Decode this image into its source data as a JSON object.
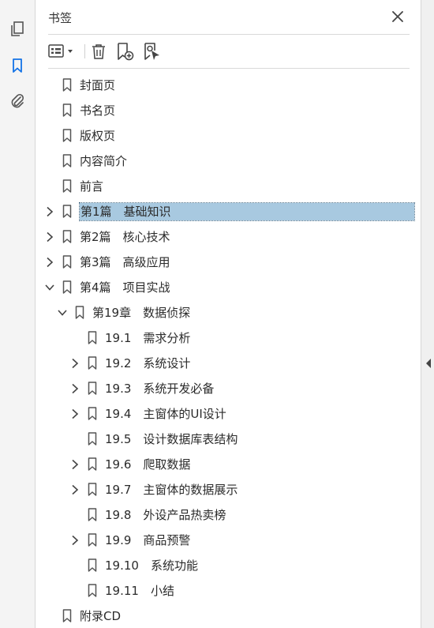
{
  "panel": {
    "title": "书签"
  },
  "rail": {
    "icons": [
      "pages-icon",
      "bookmark-icon",
      "attachment-icon"
    ]
  },
  "toolbar": {
    "buttons": [
      "options-menu-icon",
      "delete-bookmark-icon",
      "new-bookmark-icon",
      "bookmark-from-selection-icon"
    ]
  },
  "colors": {
    "selection": "#a8c9e0",
    "accent": "#1473e6",
    "icon": "#555555"
  },
  "bookmarks": [
    {
      "label": "封面页",
      "level": 0,
      "expander": "none"
    },
    {
      "label": "书名页",
      "level": 0,
      "expander": "none"
    },
    {
      "label": "版权页",
      "level": 0,
      "expander": "none"
    },
    {
      "label": "内容简介",
      "level": 0,
      "expander": "none"
    },
    {
      "label": "前言",
      "level": 0,
      "expander": "none"
    },
    {
      "label": "第1篇　基础知识",
      "level": 0,
      "expander": "collapsed",
      "selected": true
    },
    {
      "label": "第2篇　核心技术",
      "level": 0,
      "expander": "collapsed"
    },
    {
      "label": "第3篇　高级应用",
      "level": 0,
      "expander": "collapsed"
    },
    {
      "label": "第4篇　项目实战",
      "level": 0,
      "expander": "expanded"
    },
    {
      "label": "第19章　数据侦探",
      "level": 1,
      "expander": "expanded"
    },
    {
      "label": "19.1　需求分析",
      "level": 2,
      "expander": "none"
    },
    {
      "label": "19.2　系统设计",
      "level": 2,
      "expander": "collapsed"
    },
    {
      "label": "19.3　系统开发必备",
      "level": 2,
      "expander": "collapsed"
    },
    {
      "label": "19.4　主窗体的UI设计",
      "level": 2,
      "expander": "collapsed"
    },
    {
      "label": "19.5　设计数据库表结构",
      "level": 2,
      "expander": "none"
    },
    {
      "label": "19.6　爬取数据",
      "level": 2,
      "expander": "collapsed"
    },
    {
      "label": "19.7　主窗体的数据展示",
      "level": 2,
      "expander": "collapsed"
    },
    {
      "label": "19.8　外设产品热卖榜",
      "level": 2,
      "expander": "none"
    },
    {
      "label": "19.9　商品预警",
      "level": 2,
      "expander": "collapsed"
    },
    {
      "label": "19.10　系统功能",
      "level": 2,
      "expander": "none"
    },
    {
      "label": "19.11　小结",
      "level": 2,
      "expander": "none"
    },
    {
      "label": "附录CD",
      "level": 0,
      "expander": "none"
    }
  ]
}
